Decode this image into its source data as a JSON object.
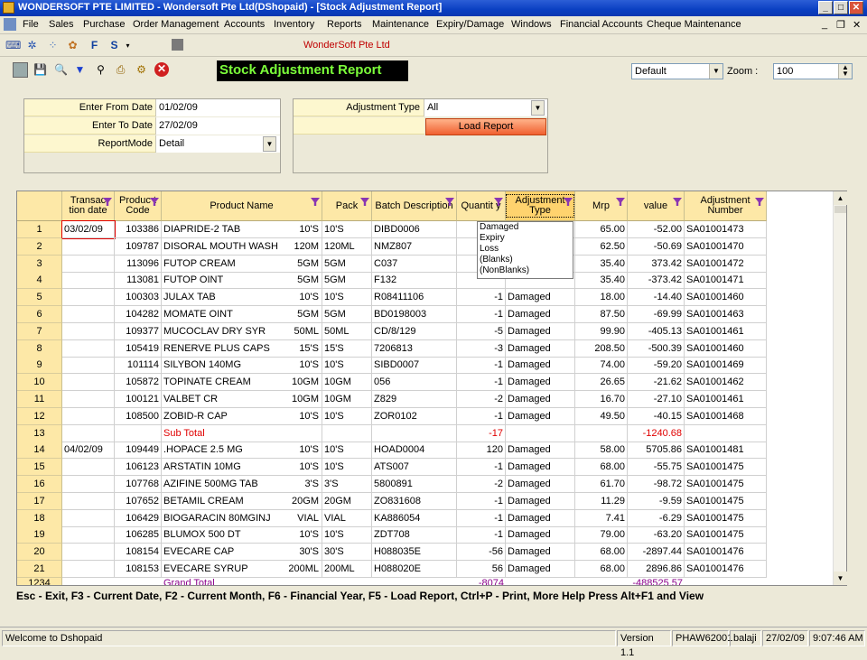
{
  "window": {
    "title": "WONDERSOFT PTE LIMITED - Wondersoft Pte Ltd(DShopaid) - [Stock Adjustment Report]",
    "min": "_",
    "max": "□",
    "close": "✕",
    "mdi_min": "_",
    "mdi_restore": "❐",
    "mdi_close": "✕"
  },
  "menu": [
    "File",
    "Sales",
    "Purchase",
    "Order Management",
    "Accounts",
    "Inventory",
    "Reports",
    "Maintenance",
    "Expiry/Damage",
    "Windows",
    "Financial Accounts",
    "Cheque Maintenance"
  ],
  "company": "WonderSoft Pte Ltd",
  "report_title": "Stock Adjustment Report",
  "layout_select": "Default",
  "zoom_label": "Zoom :",
  "zoom_value": "100",
  "filters": {
    "from_label": "Enter From Date",
    "from_value": "01/02/09",
    "to_label": "Enter To Date",
    "to_value": "27/02/09",
    "mode_label": "ReportMode",
    "mode_value": "Detail",
    "adj_label": "Adjustment Type",
    "adj_value": "All",
    "load_button": "Load Report"
  },
  "columns": {
    "date": "Transac tion date",
    "code": "Produc t Code",
    "name": "Product Name",
    "pack": "Pack",
    "batch": "Batch Description",
    "qty": "Quantit y",
    "type": "Adjustment Type",
    "mrp": "Mrp",
    "value": "value",
    "adjno": "Adjustment Number"
  },
  "type_dropdown": [
    "Damaged",
    "Expiry",
    "Loss",
    "(Blanks)",
    "(NonBlanks)"
  ],
  "rows": [
    {
      "n": "1",
      "date": "03/02/09",
      "code": "103386",
      "name": "DIAPRIDE-2 TAB",
      "size": "10'S",
      "pack": "10'S",
      "batch": "DIBD0006",
      "qty": "",
      "type": "",
      "mrp": "65.00",
      "value": "-52.00",
      "adj": "SA01001473"
    },
    {
      "n": "2",
      "date": "",
      "code": "109787",
      "name": "DISORAL MOUTH WASH",
      "size": "120M",
      "pack": "120ML",
      "batch": "NMZ807",
      "qty": "",
      "type": "",
      "mrp": "62.50",
      "value": "-50.69",
      "adj": "SA01001470"
    },
    {
      "n": "3",
      "date": "",
      "code": "113096",
      "name": "FUTOP CREAM",
      "size": "5GM",
      "pack": "5GM",
      "batch": "C037",
      "qty": "",
      "type": "",
      "mrp": "35.40",
      "value": "373.42",
      "adj": "SA01001472"
    },
    {
      "n": "4",
      "date": "",
      "code": "113081",
      "name": "FUTOP OINT",
      "size": "5GM",
      "pack": "5GM",
      "batch": "F132",
      "qty": "",
      "type": "",
      "mrp": "35.40",
      "value": "-373.42",
      "adj": "SA01001471"
    },
    {
      "n": "5",
      "date": "",
      "code": "100303",
      "name": "JULAX TAB",
      "size": "10'S",
      "pack": "10'S",
      "batch": "R08411106",
      "qty": "-1",
      "type": "Damaged",
      "mrp": "18.00",
      "value": "-14.40",
      "adj": "SA01001460"
    },
    {
      "n": "6",
      "date": "",
      "code": "104282",
      "name": "MOMATE OINT",
      "size": "5GM",
      "pack": "5GM",
      "batch": "BD0198003",
      "qty": "-1",
      "type": "Damaged",
      "mrp": "87.50",
      "value": "-69.99",
      "adj": "SA01001463"
    },
    {
      "n": "7",
      "date": "",
      "code": "109377",
      "name": "MUCOCLAV DRY SYR",
      "size": "50ML",
      "pack": "50ML",
      "batch": "CD/8/129",
      "qty": "-5",
      "type": "Damaged",
      "mrp": "99.90",
      "value": "-405.13",
      "adj": "SA01001461"
    },
    {
      "n": "8",
      "date": "",
      "code": "105419",
      "name": "RENERVE PLUS CAPS",
      "size": "15'S",
      "pack": "15'S",
      "batch": "7206813",
      "qty": "-3",
      "type": "Damaged",
      "mrp": "208.50",
      "value": "-500.39",
      "adj": "SA01001460"
    },
    {
      "n": "9",
      "date": "",
      "code": "101114",
      "name": "SILYBON 140MG",
      "size": "10'S",
      "pack": "10'S",
      "batch": "SIBD0007",
      "qty": "-1",
      "type": "Damaged",
      "mrp": "74.00",
      "value": "-59.20",
      "adj": "SA01001469"
    },
    {
      "n": "10",
      "date": "",
      "code": "105872",
      "name": "TOPINATE CREAM",
      "size": "10GM",
      "pack": "10GM",
      "batch": "056",
      "qty": "-1",
      "type": "Damaged",
      "mrp": "26.65",
      "value": "-21.62",
      "adj": "SA01001462"
    },
    {
      "n": "11",
      "date": "",
      "code": "100121",
      "name": "VALBET CR",
      "size": "10GM",
      "pack": "10GM",
      "batch": "Z829",
      "qty": "-2",
      "type": "Damaged",
      "mrp": "16.70",
      "value": "-27.10",
      "adj": "SA01001461"
    },
    {
      "n": "12",
      "date": "",
      "code": "108500",
      "name": "ZOBID-R CAP",
      "size": "10'S",
      "pack": "10'S",
      "batch": "ZOR0102",
      "qty": "-1",
      "type": "Damaged",
      "mrp": "49.50",
      "value": "-40.15",
      "adj": "SA01001468"
    },
    {
      "n": "13",
      "date": "",
      "code": "",
      "name": "Sub Total",
      "size": "",
      "pack": "",
      "batch": "",
      "qty": "-17",
      "type": "",
      "mrp": "",
      "value": "-1240.68",
      "adj": "",
      "kind": "sub"
    },
    {
      "n": "14",
      "date": "04/02/09",
      "code": "109449",
      "name": ".HOPACE 2.5 MG",
      "size": "10'S",
      "pack": "10'S",
      "batch": "HOAD0004",
      "qty": "120",
      "type": "Damaged",
      "mrp": "58.00",
      "value": "5705.86",
      "adj": "SA01001481"
    },
    {
      "n": "15",
      "date": "",
      "code": "106123",
      "name": "ARSTATIN 10MG",
      "size": "10'S",
      "pack": "10'S",
      "batch": "ATS007",
      "qty": "-1",
      "type": "Damaged",
      "mrp": "68.00",
      "value": "-55.75",
      "adj": "SA01001475"
    },
    {
      "n": "16",
      "date": "",
      "code": "107768",
      "name": "AZIFINE 500MG TAB",
      "size": "3'S",
      "pack": "3'S",
      "batch": "5800891",
      "qty": "-2",
      "type": "Damaged",
      "mrp": "61.70",
      "value": "-98.72",
      "adj": "SA01001475"
    },
    {
      "n": "17",
      "date": "",
      "code": "107652",
      "name": "BETAMIL CREAM",
      "size": "20GM",
      "pack": "20GM",
      "batch": "ZO831608",
      "qty": "-1",
      "type": "Damaged",
      "mrp": "11.29",
      "value": "-9.59",
      "adj": "SA01001475"
    },
    {
      "n": "18",
      "date": "",
      "code": "106429",
      "name": "BIOGARACIN 80MGINJ",
      "size": "VIAL",
      "pack": "VIAL",
      "batch": "KA886054",
      "qty": "-1",
      "type": "Damaged",
      "mrp": "7.41",
      "value": "-6.29",
      "adj": "SA01001475"
    },
    {
      "n": "19",
      "date": "",
      "code": "106285",
      "name": "BLUMOX 500 DT",
      "size": "10'S",
      "pack": "10'S",
      "batch": "ZDT708",
      "qty": "-1",
      "type": "Damaged",
      "mrp": "79.00",
      "value": "-63.20",
      "adj": "SA01001475"
    },
    {
      "n": "20",
      "date": "",
      "code": "108154",
      "name": "EVECARE CAP",
      "size": "30'S",
      "pack": "30'S",
      "batch": "H088035E",
      "qty": "-56",
      "type": "Damaged",
      "mrp": "68.00",
      "value": "-2897.44",
      "adj": "SA01001476"
    },
    {
      "n": "21",
      "date": "",
      "code": "108153",
      "name": "EVECARE SYRUP",
      "size": "200ML",
      "pack": "200ML",
      "batch": "H088020E",
      "qty": "56",
      "type": "Damaged",
      "mrp": "68.00",
      "value": "2896.86",
      "adj": "SA01001476"
    }
  ],
  "grand_total": {
    "n": "1234",
    "label": "Grand Total",
    "qty": "-8074",
    "value": "-488525.57"
  },
  "help_text": "Esc - Exit, F3 - Current Date, F2 - Current Month, F6 - Financial Year, F5 - Load Report, Ctrl+P - Print, More Help Press Alt+F1 and View",
  "status": {
    "welcome": "Welcome to Dshopaid",
    "version": "Version 1.1",
    "machine": "PHAW62001",
    "user": "balaji",
    "date": "27/02/09",
    "time": "9:07:46 AM"
  },
  "colors": {
    "title_bar": "#0a3fc2",
    "header_bg": "#fde8a7",
    "report_title_fg": "#7cff3a",
    "subtotal": "#e00000",
    "grandtotal": "#8b008b",
    "filter_bg": "#fdf7cf"
  }
}
